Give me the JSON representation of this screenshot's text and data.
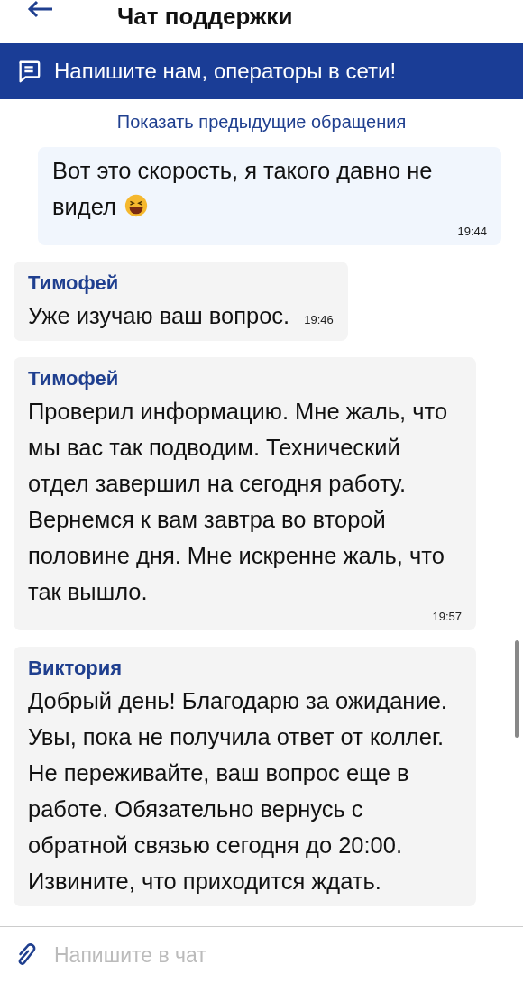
{
  "header": {
    "title": "Чат поддержки"
  },
  "banner": {
    "text": "Напишите нам, операторы в сети!"
  },
  "history_link": "Показать предыдущие обращения",
  "messages": [
    {
      "kind": "outgoing",
      "text": "Вот это скорость, я такого давно не видел",
      "emoji": true,
      "time": "19:44"
    },
    {
      "kind": "incoming",
      "author": "Тимофей",
      "text": "Уже изучаю ваш вопрос.",
      "time": "19:46",
      "inline_time": true
    },
    {
      "kind": "incoming",
      "author": "Тимофей",
      "text": "Проверил информацию. Мне жаль, что мы вас так подводим. Технический отдел завершил на сегодня работу. Вернемся к вам завтра во второй половине дня. Мне искренне жаль, что так вышло.",
      "time": "19:57",
      "inline_time": false
    },
    {
      "kind": "incoming",
      "author": "Виктория",
      "text": "Добрый день! Благодарю за ожидание. Увы, пока не получила ответ от коллег. Не переживайте, ваш вопрос еще в работе. Обязательно вернусь с обратной связью сегодня до 20:00. Извините, что приходится ждать."
    }
  ],
  "composer": {
    "placeholder": "Напишите в чат"
  }
}
